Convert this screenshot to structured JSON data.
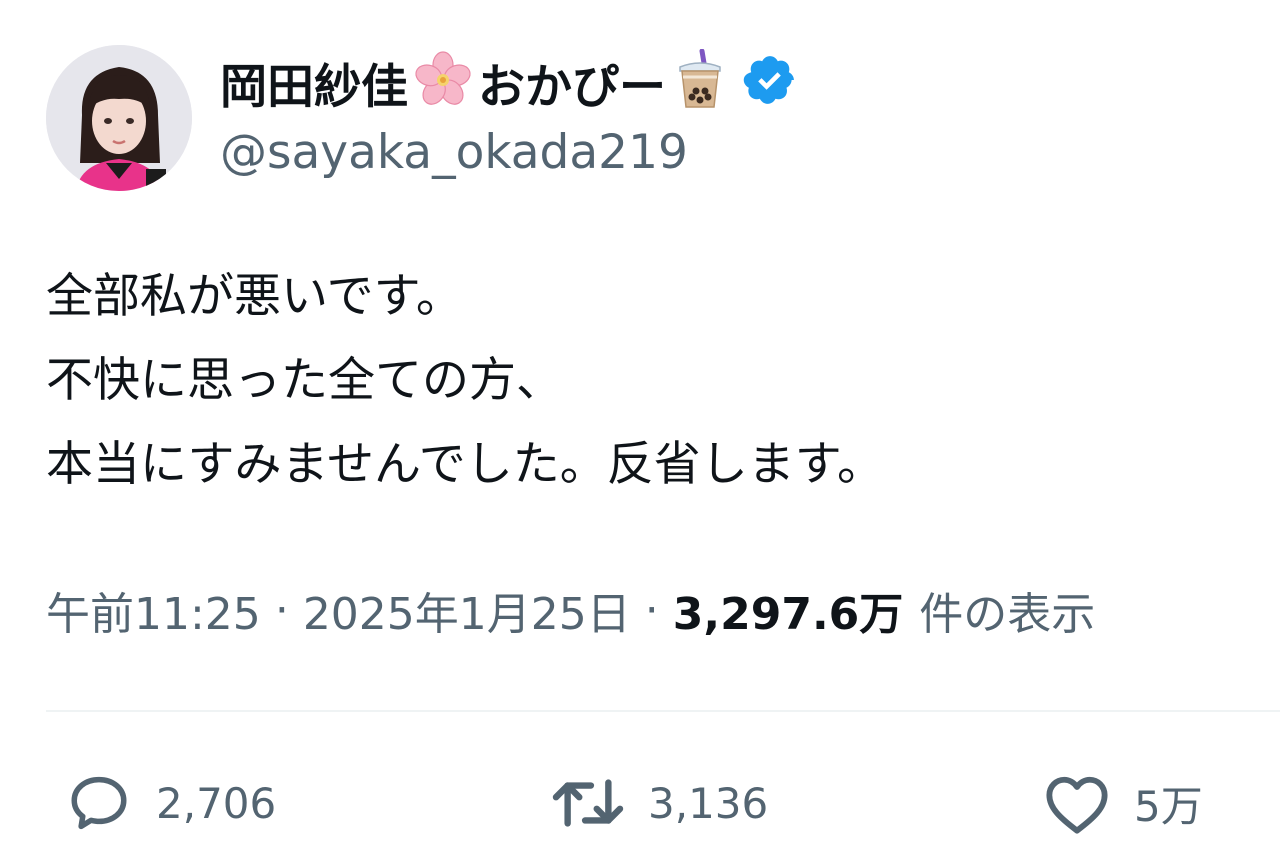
{
  "user": {
    "display_name": "岡田紗佳",
    "display_name_suffix": "おかぴー",
    "emoji_1": "sakura-icon",
    "emoji_2": "bubble-tea-icon",
    "verified_icon": "verified-badge-icon",
    "handle": "@sayaka_okada219"
  },
  "tweet": {
    "lines": [
      "全部私が悪いです。",
      "不快に思った全ての方、",
      "本当にすみませんでした。反省します。"
    ]
  },
  "meta": {
    "time": "午前11:25",
    "separator": "·",
    "date": "2025年1月25日",
    "views": "3,297.6万",
    "views_label": "件の表示"
  },
  "actions": {
    "reply_count": "2,706",
    "retweet_count": "3,136",
    "like_count": "5万"
  },
  "colors": {
    "text": "#0f1419",
    "secondary": "#536471",
    "verified": "#1d9bf0",
    "divider": "#eff3f4"
  }
}
